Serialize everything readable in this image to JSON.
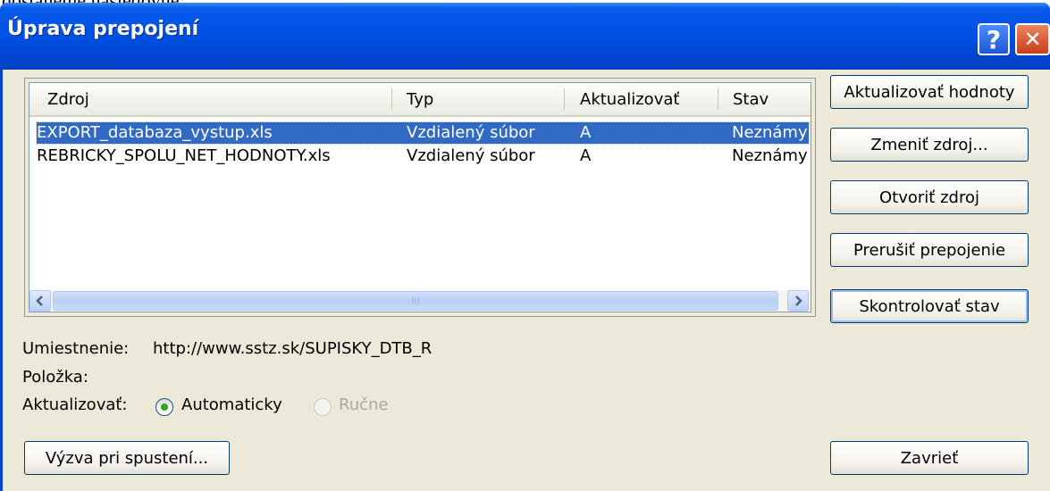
{
  "above_text": "dostaneme nasledovné:",
  "window": {
    "title": "Úprava prepojení",
    "help_label": "?",
    "close_label": "✕"
  },
  "table": {
    "columns": [
      "Zdroj",
      "Typ",
      "Aktualizovať",
      "Stav"
    ],
    "rows": [
      [
        "EXPORT_databaza_vystup.xls",
        "Vzdialený súbor",
        "A",
        "Neznámy"
      ],
      [
        "REBRICKY_SPOLU_NET_HODNOTY.xls",
        "Vzdialený súbor",
        "A",
        "Neznámy"
      ]
    ],
    "selected_row": 0,
    "scroll_left_icon": "arrow-left-icon",
    "scroll_right_icon": "arrow-right-icon",
    "thumb_grip": "III"
  },
  "buttons": {
    "update_values": "Aktualizovať hodnoty",
    "change_source": "Zmeniť zdroj...",
    "open_source": "Otvoriť zdroj",
    "break_link": "Prerušiť prepojenie",
    "check_status": "Skontrolovať stav",
    "startup_prompt": "Výzva pri spustení...",
    "close": "Zavrieť"
  },
  "details": {
    "location_label": "Umiestnenie:",
    "location_value": "http://www.sstz.sk/SUPISKY_DTB_R",
    "item_label": "Položka:",
    "update_label": "Aktualizovať:",
    "automatic_label": "Automaticky",
    "manual_label": "Ručne",
    "automatic_selected": true,
    "manual_enabled": false
  },
  "colors": {
    "titlebar": "#0052e6",
    "selection": "#316ac5",
    "dialog_bg": "#ece9d8"
  }
}
